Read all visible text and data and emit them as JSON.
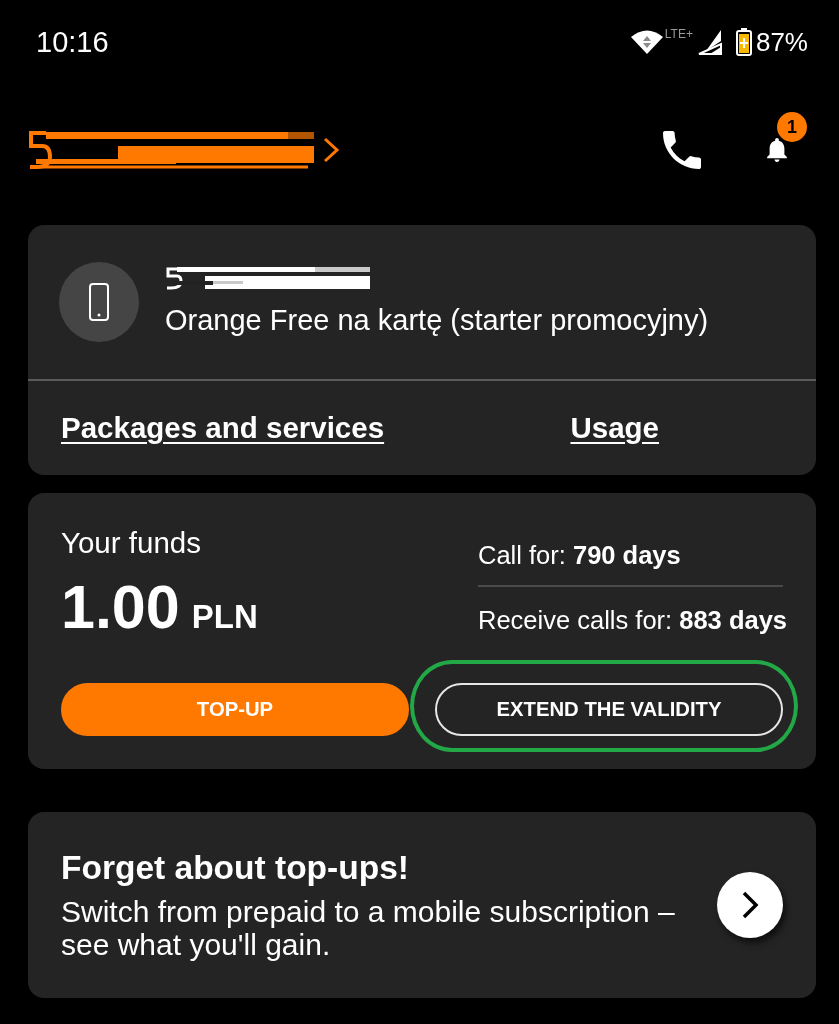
{
  "status_bar": {
    "time": "10:16",
    "network_label": "LTE+",
    "battery": "87%"
  },
  "header": {
    "notification_count": "1"
  },
  "account_card": {
    "plan": "Orange Free na kartę (starter promocyjny)",
    "links": [
      "Packages and services",
      "Usage"
    ]
  },
  "funds_card": {
    "label": "Your funds",
    "amount": "1.00",
    "currency": "PLN",
    "validity": [
      "Call for: **790 days**",
      "Receive calls for: **883 days**"
    ],
    "buttons": [
      {
        "label": "TOP-UP",
        "kind": "primary",
        "highlighted": false
      },
      {
        "label": "EXTEND THE VALIDITY",
        "kind": "outline",
        "highlighted": true
      }
    ]
  },
  "promo_card": {
    "title": "Forget about top-ups!",
    "text": "Switch from prepaid to a mobile subscription – see what you'll gain."
  }
}
